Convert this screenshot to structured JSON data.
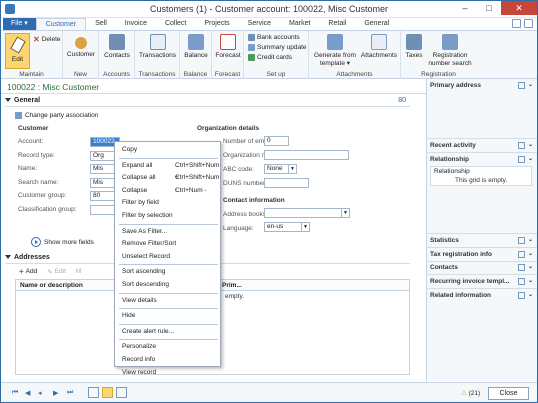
{
  "window": {
    "title": "Customers (1) - Customer account: 100022, Misc Customer",
    "minimize": "–",
    "maximize": "□",
    "close": "✕"
  },
  "ribbon_tabs": [
    "Customer",
    "Sell",
    "Invoice",
    "Collect",
    "Projects",
    "Service",
    "Market",
    "Retail",
    "General"
  ],
  "file_tab": "File ▾",
  "ribbon": {
    "maintain": {
      "edit": "Edit",
      "delete": "Delete",
      "label": "Maintain"
    },
    "new": {
      "customer": "Customer",
      "label": "New"
    },
    "accounts": {
      "contacts": "Contacts",
      "label": "Accounts"
    },
    "transactions": {
      "transactions": "Transactions",
      "label": "Transactions"
    },
    "balance": {
      "balance": "Balance",
      "label": "Balance"
    },
    "forecast": {
      "forecast": "Forecast",
      "label": "Forecast"
    },
    "setup": {
      "bank_accounts": "Bank accounts",
      "summary_update": "Summary update",
      "credit_cards": "Credit cards",
      "label": "Set up"
    },
    "attachments": {
      "generate": "Generate from",
      "template": "template ▾",
      "attachments": "Attachments",
      "label": "Attachments"
    },
    "registration": {
      "taxes": "Taxes",
      "reg_number_1": "Registration",
      "reg_number_2": "number search",
      "label": "Registration"
    }
  },
  "account_header": "100022 : Misc Customer",
  "general": {
    "title": "General",
    "count": "80",
    "change_party": "Change party association",
    "customer_group_title": "Customer",
    "org_group_title": "Organization details",
    "fields": [
      {
        "label": "Account:",
        "value": "100022"
      },
      {
        "label": "Record type:",
        "value": "Org"
      },
      {
        "label": "Name:",
        "value": "Mis"
      },
      {
        "label": "Search name:",
        "value": "Mis"
      },
      {
        "label": "Customer group:",
        "value": "80"
      },
      {
        "label": "Classification group:",
        "value": ""
      }
    ],
    "org_fields": [
      {
        "label": "Number of employees:",
        "value": "0"
      },
      {
        "label": "Organization number:",
        "value": ""
      },
      {
        "label": "ABC code:",
        "value": "None"
      },
      {
        "label": "DUNS number:",
        "value": ""
      }
    ],
    "contact_group_title": "Contact information",
    "contact_fields": [
      {
        "label": "Address books:",
        "value": ""
      },
      {
        "label": "Language:",
        "value": "en-us"
      }
    ],
    "show_more": "Show more fields"
  },
  "addresses": {
    "title": "Addresses",
    "add": "Add",
    "edit": "Edit",
    "more": "M",
    "col_name": "Name or description",
    "col_primary": "Prim...",
    "empty": "empty."
  },
  "context_menu": [
    {
      "label": "Copy",
      "shortcut": ""
    },
    {
      "sep": true
    },
    {
      "label": "Expand all",
      "shortcut": "Ctrl+Shift+Num +"
    },
    {
      "label": "Collapse all",
      "shortcut": "Ctrl+Shift+Num -"
    },
    {
      "label": "Collapse",
      "shortcut": "Ctrl+Num -"
    },
    {
      "label": "Filter by field",
      "shortcut": ""
    },
    {
      "label": "Filter by selection",
      "shortcut": ""
    },
    {
      "sep": true
    },
    {
      "label": "Save As Filter...",
      "shortcut": ""
    },
    {
      "label": "Remove Filter/Sort",
      "shortcut": ""
    },
    {
      "label": "Unselect Record",
      "shortcut": ""
    },
    {
      "sep": true
    },
    {
      "label": "Sort ascending",
      "shortcut": ""
    },
    {
      "label": "Sort descending",
      "shortcut": ""
    },
    {
      "sep": true
    },
    {
      "label": "View details",
      "shortcut": ""
    },
    {
      "sep": true
    },
    {
      "label": "Hide",
      "shortcut": ""
    },
    {
      "sep": true
    },
    {
      "label": "Create alert rule...",
      "shortcut": ""
    },
    {
      "sep": true
    },
    {
      "label": "Personalize",
      "shortcut": ""
    },
    {
      "label": "Record info",
      "shortcut": ""
    },
    {
      "label": "View record",
      "shortcut": ""
    }
  ],
  "factbox": {
    "primary_address": "Primary address",
    "recent_activity": "Recent activity",
    "relationship": "Relationship",
    "rel_col": "Relationship",
    "rel_empty": "This grid is empty.",
    "statistics": "Statistics",
    "tax_registration": "Tax registration info",
    "contacts": "Contacts",
    "recurring_invoice": "Recurring invoice templ...",
    "related_info": "Related information"
  },
  "statusbar": {
    "notifications": "(21)",
    "close": "Close"
  }
}
